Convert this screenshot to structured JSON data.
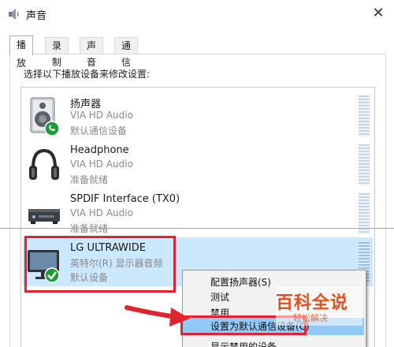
{
  "window": {
    "title": "声音"
  },
  "tabs": [
    "播放",
    "录制",
    "声音",
    "通信"
  ],
  "instruction": "选择以下播放设备来修改设置:",
  "devices": [
    {
      "name": "扬声器",
      "driver": "VIA HD Audio",
      "status": "默认通信设备",
      "icon": "speaker-icon"
    },
    {
      "name": "Headphone",
      "driver": "VIA HD Audio",
      "status": "准备就绪",
      "icon": "headphone-icon"
    },
    {
      "name": "SPDIF Interface (TX0)",
      "driver": "VIA HD Audio",
      "status": "准备就绪",
      "icon": "spdif-device-icon"
    },
    {
      "name": "LG ULTRAWIDE",
      "driver": "英特尔(R) 显示器音频",
      "status": "默认设备",
      "icon": "monitor-icon"
    }
  ],
  "context_menu": [
    "配置扬声器(S)",
    "测试",
    "禁用",
    "设置为默认通信设备(C)",
    "显示禁用的设备"
  ],
  "watermark": {
    "main": "百科全说",
    "sub": "轻松解决"
  },
  "colors": {
    "selection": "#cce8ff",
    "menu_highlight": "#91c9f7",
    "annotation_red": "#e0242f",
    "default_check": "#1e9c3c"
  }
}
